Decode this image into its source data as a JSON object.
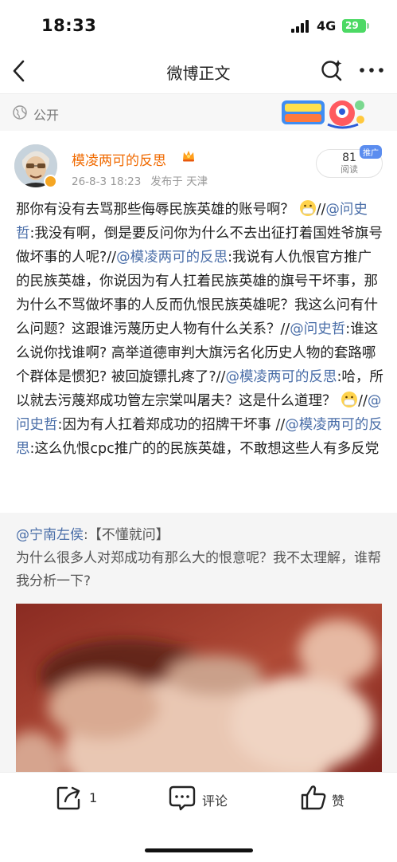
{
  "status_bar": {
    "time": "18:33",
    "network": "4G",
    "battery": "29"
  },
  "nav": {
    "title": "微博正文"
  },
  "visibility": {
    "label": "公开"
  },
  "author": {
    "name": "模凌两可的反思",
    "date": "26-8-3 18:23",
    "published_from": "发布于 天津"
  },
  "read_stats": {
    "count": "81",
    "label": "阅读",
    "badge": "推广"
  },
  "post": {
    "t1": "那你有没有去骂那些侮辱民族英雄的账号啊？ ",
    "t2": "//",
    "m1": "@问史哲",
    "t3": ":我没有啊，倒是要反问你为什么不去出征打着国姓爷旗号做坏事的人呢?//",
    "m2": "@模凌两可的反思",
    "t4": ":我说有人仇恨官方推广的民族英雄，你说因为有人扛着民族英雄的旗号干坏事，那为什么不骂做坏事的人反而仇恨民族英雄呢？我这么问有什么问题？这跟谁污蔑历史人物有什么关系？//",
    "m3": "@问史哲",
    "t5": ":谁这么说你找谁啊? 高举道德审判大旗污名化历史人物的套路哪个群体是惯犯? 被回旋镖扎疼了?//",
    "m4": "@模凌两可的反思",
    "t6": ":哈，所以就去污蔑郑成功管左宗棠叫屠夫？这是什么道理？ ",
    "t7": "//",
    "m5": "@问史哲",
    "t8": ":因为有人扛着郑成功的招牌干坏事 //",
    "m6": "@模凌两可的反思",
    "t9": ":这么仇恨cpc推广的的民族英雄，不敢想这些人有多反党"
  },
  "repost": {
    "mention": "@宁南左侯",
    "text1": ":【不懂就问】",
    "text2": "为什么很多人对郑成功有那么大的恨意呢？我不太理解，谁帮我分析一下?"
  },
  "actions": {
    "share_count": "1",
    "comment_label": "评论",
    "like_label": "赞"
  },
  "icons": [
    "back-arrow-icon",
    "search-sparkle-icon",
    "more-dots-icon",
    "globe-icon",
    "crown-icon",
    "mask-emoji-icon",
    "share-icon",
    "comment-icon",
    "thumbs-up-icon"
  ]
}
